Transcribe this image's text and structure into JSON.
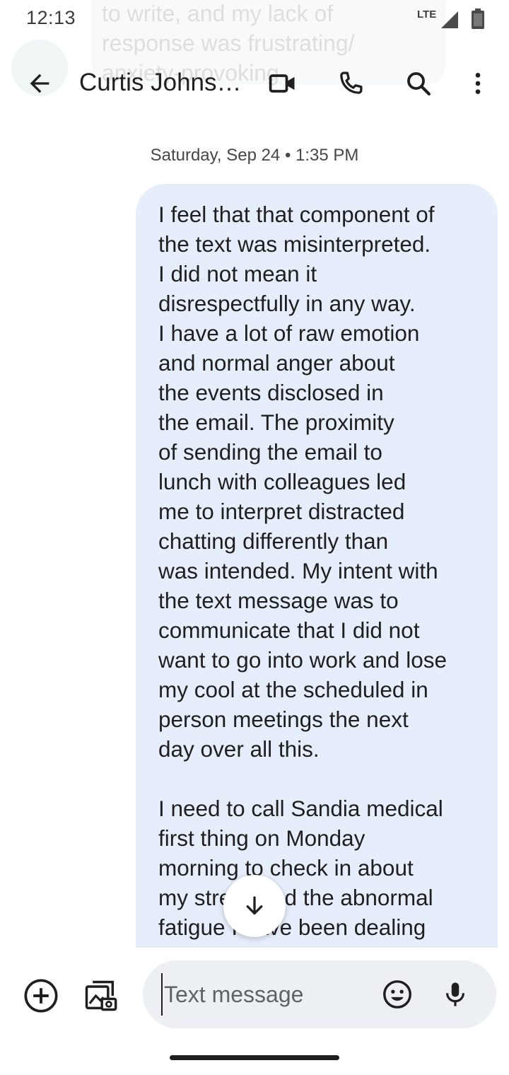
{
  "background_preview": {
    "text": "to write, and my lack of\nresponse was frustrating/\nanxiety-provoking"
  },
  "status_bar": {
    "time": "12:13",
    "network": "LTE",
    "icons": [
      "signal-icon",
      "battery-icon"
    ]
  },
  "top_bar": {
    "contact_name": "Curtis Johns…",
    "icons": [
      "back-arrow-icon",
      "video-call-icon",
      "phone-call-icon",
      "search-icon",
      "more-vert-icon"
    ]
  },
  "conversation": {
    "date_separator": "Saturday, Sep 24 • 1:35 PM",
    "message": {
      "direction": "outgoing",
      "text": "I feel that that component of\nthe text was misinterpreted.\nI did not mean it\ndisrespectfully in any way.\nI have a lot of raw emotion\nand normal anger about\nthe events disclosed in\nthe email. The proximity\nof sending the email to\nlunch with colleagues led\nme to interpret distracted\nchatting differently than\nwas intended. My intent with\nthe text message was to\ncommunicate that I did not\nwant to go into work and lose\nmy cool at the scheduled in\nperson meetings the next\nday over all this.\n\nI need to call Sandia medical\nfirst thing on Monday\nmorning to check in about\nmy stress and the abnormal\nfatigue I have been dealing\nwith since composing the"
    }
  },
  "compose": {
    "placeholder": "Text message",
    "value": "",
    "icons": [
      "add-circle-icon",
      "gallery-icon",
      "emoji-icon",
      "mic-icon"
    ]
  },
  "scroll_fab": {
    "icon": "arrow-down-icon"
  },
  "colors": {
    "bubble_background": "#e6edfb",
    "compose_background": "#eceff3",
    "text": "#1f1f1f"
  }
}
